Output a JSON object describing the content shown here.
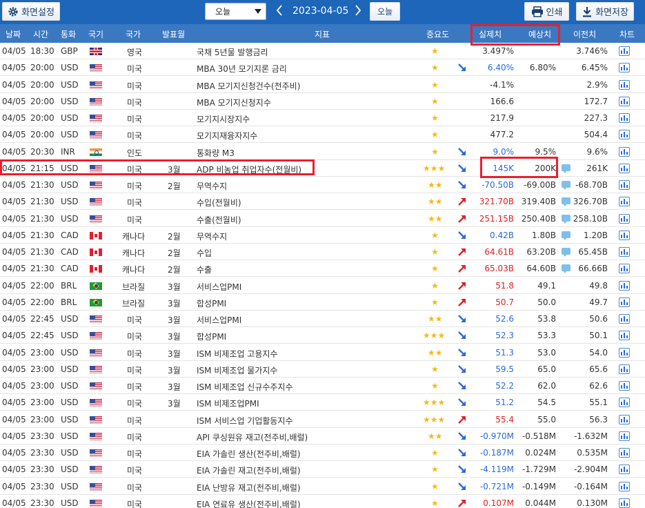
{
  "toolbar": {
    "settings_label": "화면설정",
    "period_select": "오늘",
    "date": "2023-04-05",
    "today_label": "오늘",
    "print_label": "인쇄",
    "save_label": "화면저장"
  },
  "columns": [
    "날짜",
    "시간",
    "통화",
    "국기",
    "국가",
    "발표월",
    "지표",
    "중요도",
    "실제치",
    "예상치",
    "이전치",
    "차트"
  ],
  "rows": [
    {
      "date": "04/05",
      "time": "18:30",
      "currency": "GBP",
      "flag": "gb",
      "country": "영국",
      "month": "",
      "indicator": "국채 5년물 발행금리",
      "stars": 1,
      "trend": "",
      "actual": "3.497%",
      "actual_color": "neutral",
      "forecast": "",
      "bubble": false,
      "previous": "3.746%"
    },
    {
      "date": "04/05",
      "time": "20:00",
      "currency": "USD",
      "flag": "us",
      "country": "미국",
      "month": "",
      "indicator": "MBA 30년 모기지론 금리",
      "stars": 1,
      "trend": "down",
      "actual": "6.40%",
      "actual_color": "blue",
      "forecast": "6.80%",
      "bubble": false,
      "previous": "6.45%"
    },
    {
      "date": "04/05",
      "time": "20:00",
      "currency": "USD",
      "flag": "us",
      "country": "미국",
      "month": "",
      "indicator": "MBA 모기지신청건수(전주비)",
      "stars": 1,
      "trend": "",
      "actual": "-4.1%",
      "actual_color": "neutral",
      "forecast": "",
      "bubble": false,
      "previous": "2.9%"
    },
    {
      "date": "04/05",
      "time": "20:00",
      "currency": "USD",
      "flag": "us",
      "country": "미국",
      "month": "",
      "indicator": "MBA 모기지신청지수",
      "stars": 1,
      "trend": "",
      "actual": "166.6",
      "actual_color": "neutral",
      "forecast": "",
      "bubble": false,
      "previous": "172.7"
    },
    {
      "date": "04/05",
      "time": "20:00",
      "currency": "USD",
      "flag": "us",
      "country": "미국",
      "month": "",
      "indicator": "모기지시장지수",
      "stars": 1,
      "trend": "",
      "actual": "217.9",
      "actual_color": "neutral",
      "forecast": "",
      "bubble": false,
      "previous": "227.3"
    },
    {
      "date": "04/05",
      "time": "20:00",
      "currency": "USD",
      "flag": "us",
      "country": "미국",
      "month": "",
      "indicator": "모기지재융자지수",
      "stars": 1,
      "trend": "",
      "actual": "477.2",
      "actual_color": "neutral",
      "forecast": "",
      "bubble": false,
      "previous": "504.4"
    },
    {
      "date": "04/05",
      "time": "20:30",
      "currency": "INR",
      "flag": "in",
      "country": "인도",
      "month": "",
      "indicator": "통화량 M3",
      "stars": 1,
      "trend": "down",
      "actual": "9.0%",
      "actual_color": "blue",
      "forecast": "9.5%",
      "bubble": false,
      "previous": "9.6%"
    },
    {
      "date": "04/05",
      "time": "21:15",
      "currency": "USD",
      "flag": "us",
      "country": "미국",
      "month": "3월",
      "indicator": "ADP 비농업 취업자수(전월비)",
      "stars": 3,
      "trend": "down",
      "actual": "145K",
      "actual_color": "blue",
      "forecast": "200K",
      "bubble": true,
      "previous": "261K"
    },
    {
      "date": "04/05",
      "time": "21:30",
      "currency": "USD",
      "flag": "us",
      "country": "미국",
      "month": "2월",
      "indicator": "무역수지",
      "stars": 2,
      "trend": "down",
      "actual": "-70.50B",
      "actual_color": "blue",
      "forecast": "-69.00B",
      "bubble": true,
      "previous": "-68.70B"
    },
    {
      "date": "04/05",
      "time": "21:30",
      "currency": "USD",
      "flag": "us",
      "country": "미국",
      "month": "",
      "indicator": "수입(전월비)",
      "stars": 2,
      "trend": "up",
      "actual": "321.70B",
      "actual_color": "red",
      "forecast": "319.40B",
      "bubble": true,
      "previous": "326.70B"
    },
    {
      "date": "04/05",
      "time": "21:30",
      "currency": "USD",
      "flag": "us",
      "country": "미국",
      "month": "",
      "indicator": "수출(전월비)",
      "stars": 2,
      "trend": "up",
      "actual": "251.15B",
      "actual_color": "red",
      "forecast": "250.40B",
      "bubble": true,
      "previous": "258.10B"
    },
    {
      "date": "04/05",
      "time": "21:30",
      "currency": "CAD",
      "flag": "ca",
      "country": "캐나다",
      "month": "2월",
      "indicator": "무역수지",
      "stars": 1,
      "trend": "down",
      "actual": "0.42B",
      "actual_color": "blue",
      "forecast": "1.80B",
      "bubble": true,
      "previous": "1.20B"
    },
    {
      "date": "04/05",
      "time": "21:30",
      "currency": "CAD",
      "flag": "ca",
      "country": "캐나다",
      "month": "2월",
      "indicator": "수입",
      "stars": 1,
      "trend": "up",
      "actual": "64.61B",
      "actual_color": "red",
      "forecast": "63.20B",
      "bubble": true,
      "previous": "65.45B"
    },
    {
      "date": "04/05",
      "time": "21:30",
      "currency": "CAD",
      "flag": "ca",
      "country": "캐나다",
      "month": "2월",
      "indicator": "수출",
      "stars": 1,
      "trend": "up",
      "actual": "65.03B",
      "actual_color": "red",
      "forecast": "64.60B",
      "bubble": true,
      "previous": "66.66B"
    },
    {
      "date": "04/05",
      "time": "22:00",
      "currency": "BRL",
      "flag": "br",
      "country": "브라질",
      "month": "3월",
      "indicator": "서비스업PMI",
      "stars": 1,
      "trend": "up",
      "actual": "51.8",
      "actual_color": "red",
      "forecast": "49.1",
      "bubble": false,
      "previous": "49.8"
    },
    {
      "date": "04/05",
      "time": "22:00",
      "currency": "BRL",
      "flag": "br",
      "country": "브라질",
      "month": "3월",
      "indicator": "합성PMI",
      "stars": 1,
      "trend": "up",
      "actual": "50.7",
      "actual_color": "red",
      "forecast": "50.0",
      "bubble": false,
      "previous": "49.7"
    },
    {
      "date": "04/05",
      "time": "22:45",
      "currency": "USD",
      "flag": "us",
      "country": "미국",
      "month": "3월",
      "indicator": "서비스업PMI",
      "stars": 2,
      "trend": "down",
      "actual": "52.6",
      "actual_color": "blue",
      "forecast": "53.8",
      "bubble": false,
      "previous": "50.6"
    },
    {
      "date": "04/05",
      "time": "22:45",
      "currency": "USD",
      "flag": "us",
      "country": "미국",
      "month": "3월",
      "indicator": "합성PMI",
      "stars": 3,
      "trend": "down",
      "actual": "52.3",
      "actual_color": "blue",
      "forecast": "53.3",
      "bubble": false,
      "previous": "50.1"
    },
    {
      "date": "04/05",
      "time": "23:00",
      "currency": "USD",
      "flag": "us",
      "country": "미국",
      "month": "3월",
      "indicator": "ISM 비제조업 고용지수",
      "stars": 2,
      "trend": "down",
      "actual": "51.3",
      "actual_color": "blue",
      "forecast": "53.0",
      "bubble": false,
      "previous": "54.0"
    },
    {
      "date": "04/05",
      "time": "23:00",
      "currency": "USD",
      "flag": "us",
      "country": "미국",
      "month": "3월",
      "indicator": "ISM 비제조업 물가지수",
      "stars": 1,
      "trend": "down",
      "actual": "59.5",
      "actual_color": "blue",
      "forecast": "65.0",
      "bubble": false,
      "previous": "65.6"
    },
    {
      "date": "04/05",
      "time": "23:00",
      "currency": "USD",
      "flag": "us",
      "country": "미국",
      "month": "3월",
      "indicator": "ISM 비제조업 신규수주지수",
      "stars": 1,
      "trend": "down",
      "actual": "52.2",
      "actual_color": "blue",
      "forecast": "62.0",
      "bubble": false,
      "previous": "62.6"
    },
    {
      "date": "04/05",
      "time": "23:00",
      "currency": "USD",
      "flag": "us",
      "country": "미국",
      "month": "3월",
      "indicator": "ISM 비제조업PMI",
      "stars": 3,
      "trend": "down",
      "actual": "51.2",
      "actual_color": "blue",
      "forecast": "54.5",
      "bubble": false,
      "previous": "55.1"
    },
    {
      "date": "04/05",
      "time": "23:00",
      "currency": "USD",
      "flag": "us",
      "country": "미국",
      "month": "",
      "indicator": "ISM 서비스업 기업활동지수",
      "stars": 3,
      "trend": "up",
      "actual": "55.4",
      "actual_color": "red",
      "forecast": "55.0",
      "bubble": false,
      "previous": "56.3"
    },
    {
      "date": "04/05",
      "time": "23:30",
      "currency": "USD",
      "flag": "us",
      "country": "미국",
      "month": "",
      "indicator": "API 쿠싱원유 재고(전주비,배럴)",
      "stars": 2,
      "trend": "down",
      "actual": "-0.970M",
      "actual_color": "blue",
      "forecast": "-0.518M",
      "bubble": false,
      "previous": "-1.632M"
    },
    {
      "date": "04/05",
      "time": "23:30",
      "currency": "USD",
      "flag": "us",
      "country": "미국",
      "month": "",
      "indicator": "EIA 가솔린 생산(전주비,배럴)",
      "stars": 1,
      "trend": "down",
      "actual": "-0.187M",
      "actual_color": "blue",
      "forecast": "0.024M",
      "bubble": false,
      "previous": "0.535M"
    },
    {
      "date": "04/05",
      "time": "23:30",
      "currency": "USD",
      "flag": "us",
      "country": "미국",
      "month": "",
      "indicator": "EIA 가솔린 재고(전주비,배럴)",
      "stars": 1,
      "trend": "down",
      "actual": "-4.119M",
      "actual_color": "blue",
      "forecast": "-1.729M",
      "bubble": false,
      "previous": "-2.904M"
    },
    {
      "date": "04/05",
      "time": "23:30",
      "currency": "USD",
      "flag": "us",
      "country": "미국",
      "month": "",
      "indicator": "EIA 난방유 재고(전주비,배럴)",
      "stars": 1,
      "trend": "down",
      "actual": "-0.721M",
      "actual_color": "blue",
      "forecast": "-0.149M",
      "bubble": false,
      "previous": "-0.164M"
    },
    {
      "date": "04/05",
      "time": "23:30",
      "currency": "USD",
      "flag": "us",
      "country": "미국",
      "month": "",
      "indicator": "EIA 연료유 생산(전주비,배럴)",
      "stars": 1,
      "trend": "up",
      "actual": "0.107M",
      "actual_color": "red",
      "forecast": "0.044M",
      "bubble": false,
      "previous": "0.130M"
    }
  ],
  "colors": {
    "toolbar": "#1d66b9",
    "header": "#3b78c2",
    "highlight": "#e8202c",
    "up": "#e02020",
    "down": "#2a6ad8"
  }
}
